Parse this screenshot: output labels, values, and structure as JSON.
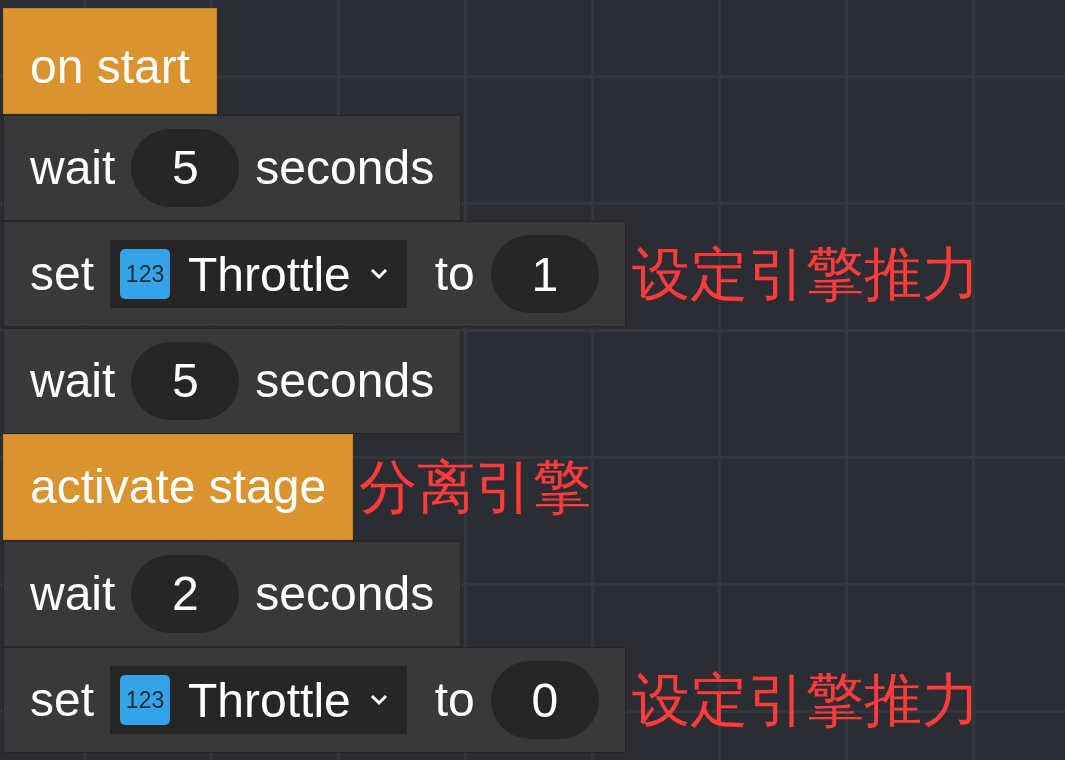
{
  "blocks": [
    {
      "kind": "event",
      "label": "on start"
    },
    {
      "kind": "wait",
      "label": "wait",
      "value": "5",
      "unit": "seconds"
    },
    {
      "kind": "set",
      "label": "set",
      "variable": {
        "icon_text": "123",
        "name": "Throttle"
      },
      "to": "to",
      "value": "1",
      "comment": "设定引擎推力"
    },
    {
      "kind": "wait",
      "label": "wait",
      "value": "5",
      "unit": "seconds"
    },
    {
      "kind": "action",
      "label": "activate stage",
      "comment": "分离引擎"
    },
    {
      "kind": "wait",
      "label": "wait",
      "value": "2",
      "unit": "seconds"
    },
    {
      "kind": "set",
      "label": "set",
      "variable": {
        "icon_text": "123",
        "name": "Throttle"
      },
      "to": "to",
      "value": "0",
      "comment": "设定引擎推力"
    }
  ]
}
